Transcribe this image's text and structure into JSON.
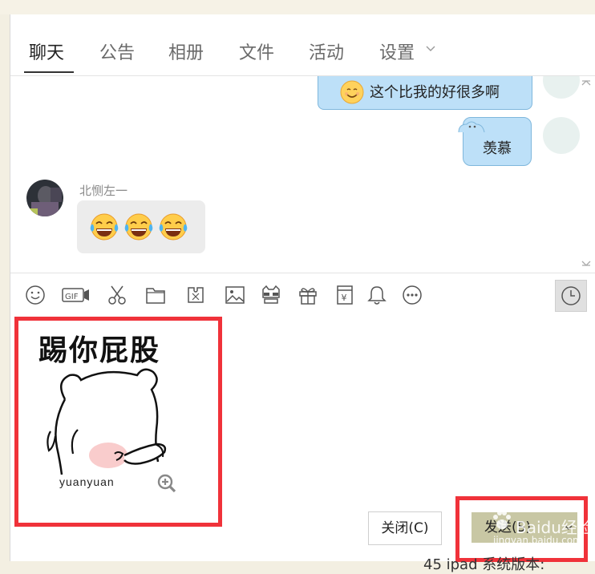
{
  "tabs": [
    {
      "label": "聊天",
      "active": true
    },
    {
      "label": "公告"
    },
    {
      "label": "相册"
    },
    {
      "label": "文件"
    },
    {
      "label": "活动"
    },
    {
      "label": "设置"
    }
  ],
  "messages": {
    "outgoing_1": "这个比我的好很多啊",
    "outgoing_2": "羡慕",
    "incoming_sender": "北恻左一"
  },
  "toolbar_icons": [
    "smile-icon",
    "gif-icon",
    "scissors-icon",
    "folder-icon",
    "puzzle-icon",
    "image-icon",
    "cat-icon",
    "gift-icon",
    "money-icon",
    "bell-icon",
    "more-icon",
    "history-icon"
  ],
  "sticker": {
    "title": "踢你屁股",
    "caption": "yuanyuan"
  },
  "buttons": {
    "close": "关闭(C)",
    "send": "发送(S)"
  },
  "watermark": {
    "brand": "Baidu经验",
    "url": "jingyan.baidu.com"
  },
  "background_text": "45 ipad 系统版本:",
  "colors": {
    "highlight_box": "#f0323a",
    "send_button": "#c8c7a4",
    "bubble_blue": "#bde0f8"
  }
}
